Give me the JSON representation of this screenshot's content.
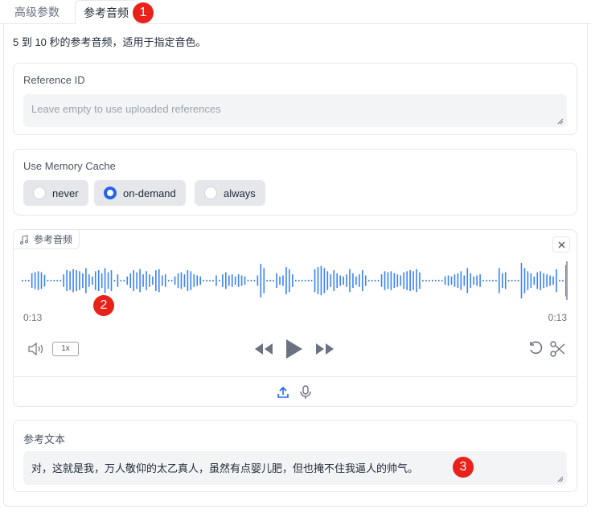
{
  "tabs": [
    {
      "label": "高级参数"
    },
    {
      "label": "参考音频"
    }
  ],
  "markers": [
    "1",
    "2",
    "3"
  ],
  "description": "5 到 10 秒的参考音频，适用于指定音色。",
  "reference_id": {
    "label": "Reference ID",
    "placeholder": "Leave empty to use uploaded references",
    "value": ""
  },
  "memory_cache": {
    "label": "Use Memory Cache",
    "options": [
      "never",
      "on-demand",
      "always"
    ],
    "selected": "on-demand"
  },
  "audio": {
    "label": "参考音频",
    "current_time": "0:13",
    "duration": "0:13",
    "playback_speed": "1x",
    "waveform": [
      0.04,
      0.04,
      0.04,
      0.35,
      0.4,
      0.45,
      0.4,
      0.28,
      0.04,
      0.04,
      0.04,
      0.04,
      0.04,
      0.3,
      0.5,
      0.45,
      0.55,
      0.5,
      0.45,
      0.35,
      0.6,
      0.3,
      0.2,
      0.45,
      0.5,
      0.35,
      0.6,
      0.4,
      0.5,
      0.04,
      0.3,
      0.04,
      0.04,
      0.2,
      0.35,
      0.5,
      0.4,
      0.55,
      0.3,
      0.45,
      0.3,
      0.2,
      0.5,
      0.55,
      0.25,
      0.3,
      0.04,
      0.04,
      0.2,
      0.35,
      0.4,
      0.3,
      0.5,
      0.45,
      0.3,
      0.25,
      0.2,
      0.04,
      0.04,
      0.04,
      0.04,
      0.25,
      0.04,
      0.3,
      0.4,
      0.25,
      0.3,
      0.2,
      0.3,
      0.25,
      0.2,
      0.04,
      0.04,
      0.04,
      0.25,
      0.8,
      0.6,
      0.04,
      0.04,
      0.04,
      0.35,
      0.2,
      0.25,
      0.65,
      0.55,
      0.3,
      0.04,
      0.04,
      0.04,
      0.04,
      0.04,
      0.04,
      0.55,
      0.65,
      0.7,
      0.6,
      0.45,
      0.3,
      0.5,
      0.35,
      0.25,
      0.2,
      0.3,
      0.55,
      0.35,
      0.2,
      0.3,
      0.5,
      0.25,
      0.04,
      0.04,
      0.04,
      0.04,
      0.3,
      0.45,
      0.4,
      0.45,
      0.35,
      0.3,
      0.25,
      0.4,
      0.45,
      0.5,
      0.45,
      0.55,
      0.4,
      0.04,
      0.04,
      0.04,
      0.04,
      0.04,
      0.04,
      0.04,
      0.2,
      0.25,
      0.2,
      0.3,
      0.35,
      0.45,
      0.25,
      0.6,
      0.35,
      0.2,
      0.25,
      0.3,
      0.04,
      0.04,
      0.04,
      0.04,
      0.04,
      0.6,
      0.35,
      0.4,
      0.04,
      0.04,
      0.04,
      0.04,
      0.85,
      0.6,
      0.45,
      0.35,
      0.2,
      0.4,
      0.45,
      0.35,
      0.3,
      0.25,
      0.2,
      0.55,
      0.04,
      0.04,
      0.75
    ],
    "progress": 1.0
  },
  "ref_text": {
    "label": "参考文本",
    "value": "对，这就是我，万人敬仰的太乙真人，虽然有点婴儿肥，但也掩不住我逼人的帅气。"
  },
  "colors": {
    "accent": "#2563eb",
    "wave": "#3b82f6",
    "marker": "#e8211a"
  }
}
